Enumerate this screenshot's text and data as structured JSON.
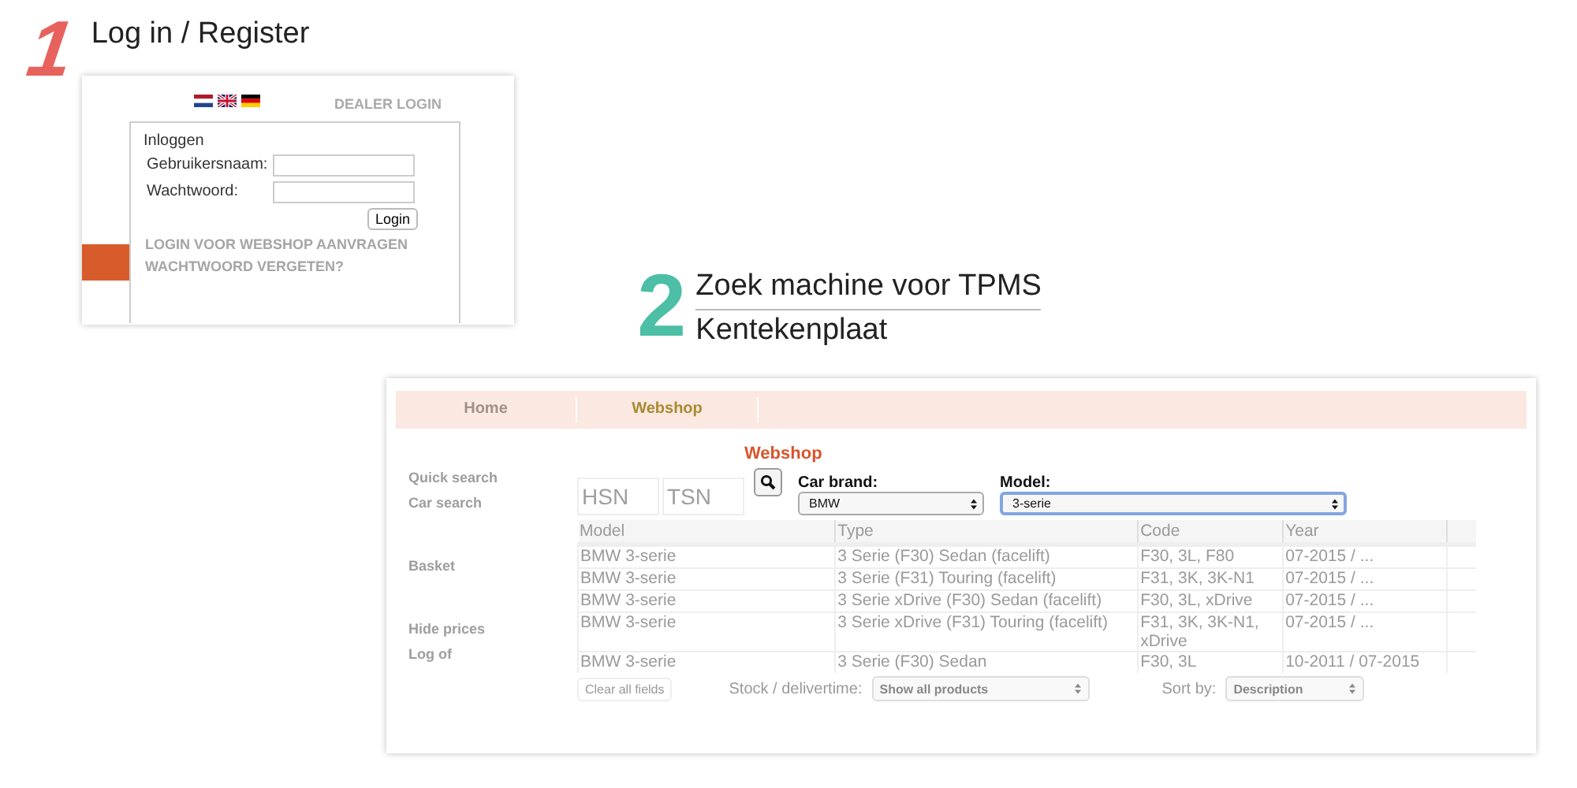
{
  "step1": {
    "number": "1",
    "title": "Log in / Register"
  },
  "login_panel": {
    "dealer_login": "DEALER LOGIN",
    "heading": "Inloggen",
    "fields": [
      {
        "label": "Gebruikersnaam:"
      },
      {
        "label": "Wachtwoord:"
      }
    ],
    "button": "Login",
    "links": [
      "LOGIN VOOR WEBSHOP AANVRAGEN",
      "WACHTWOORD VERGETEN?"
    ]
  },
  "step2": {
    "number": "2",
    "title": "Zoek machine voor TPMS",
    "subtitle": "Kentekenplaat"
  },
  "webshop": {
    "nav": [
      {
        "label": "Home",
        "selected": false
      },
      {
        "label": "Webshop",
        "selected": true
      }
    ],
    "heading": "Webshop",
    "sidebar": [
      "Quick search",
      "Car search",
      "Basket",
      "Hide prices",
      "Log of"
    ],
    "hsn": {
      "placeholder": "HSN"
    },
    "tsn": {
      "placeholder": "TSN"
    },
    "car_brand": {
      "label": "Car brand:",
      "value": "BMW",
      "focused": false
    },
    "model": {
      "label": "Model:",
      "value": "3-serie",
      "focused": true
    },
    "table": {
      "columns": [
        "Model",
        "Type",
        "Code",
        "Year"
      ],
      "rows": [
        [
          "BMW 3-serie",
          "3 Serie (F30) Sedan (facelift)",
          "F30, 3L, F80",
          "07-2015 / ..."
        ],
        [
          "BMW 3-serie",
          "3 Serie (F31) Touring (facelift)",
          "F31, 3K, 3K-N1",
          "07-2015 / ..."
        ],
        [
          "BMW 3-serie",
          "3 Serie xDrive (F30) Sedan (facelift)",
          "F30, 3L, xDrive",
          "07-2015 / ..."
        ],
        [
          "BMW 3-serie",
          "3 Serie xDrive (F31) Touring (facelift)",
          "F31, 3K, 3K-N1, xDrive",
          "07-2015 / ..."
        ],
        [
          "BMW 3-serie",
          "3 Serie (F30) Sedan",
          "F30, 3L",
          "10-2011 / 07-2015"
        ]
      ]
    },
    "clear_button": "Clear all fields",
    "stock": {
      "label": "Stock / delivertime:",
      "value": "Show all products"
    },
    "sort": {
      "label": "Sort by:",
      "value": "Description"
    }
  }
}
